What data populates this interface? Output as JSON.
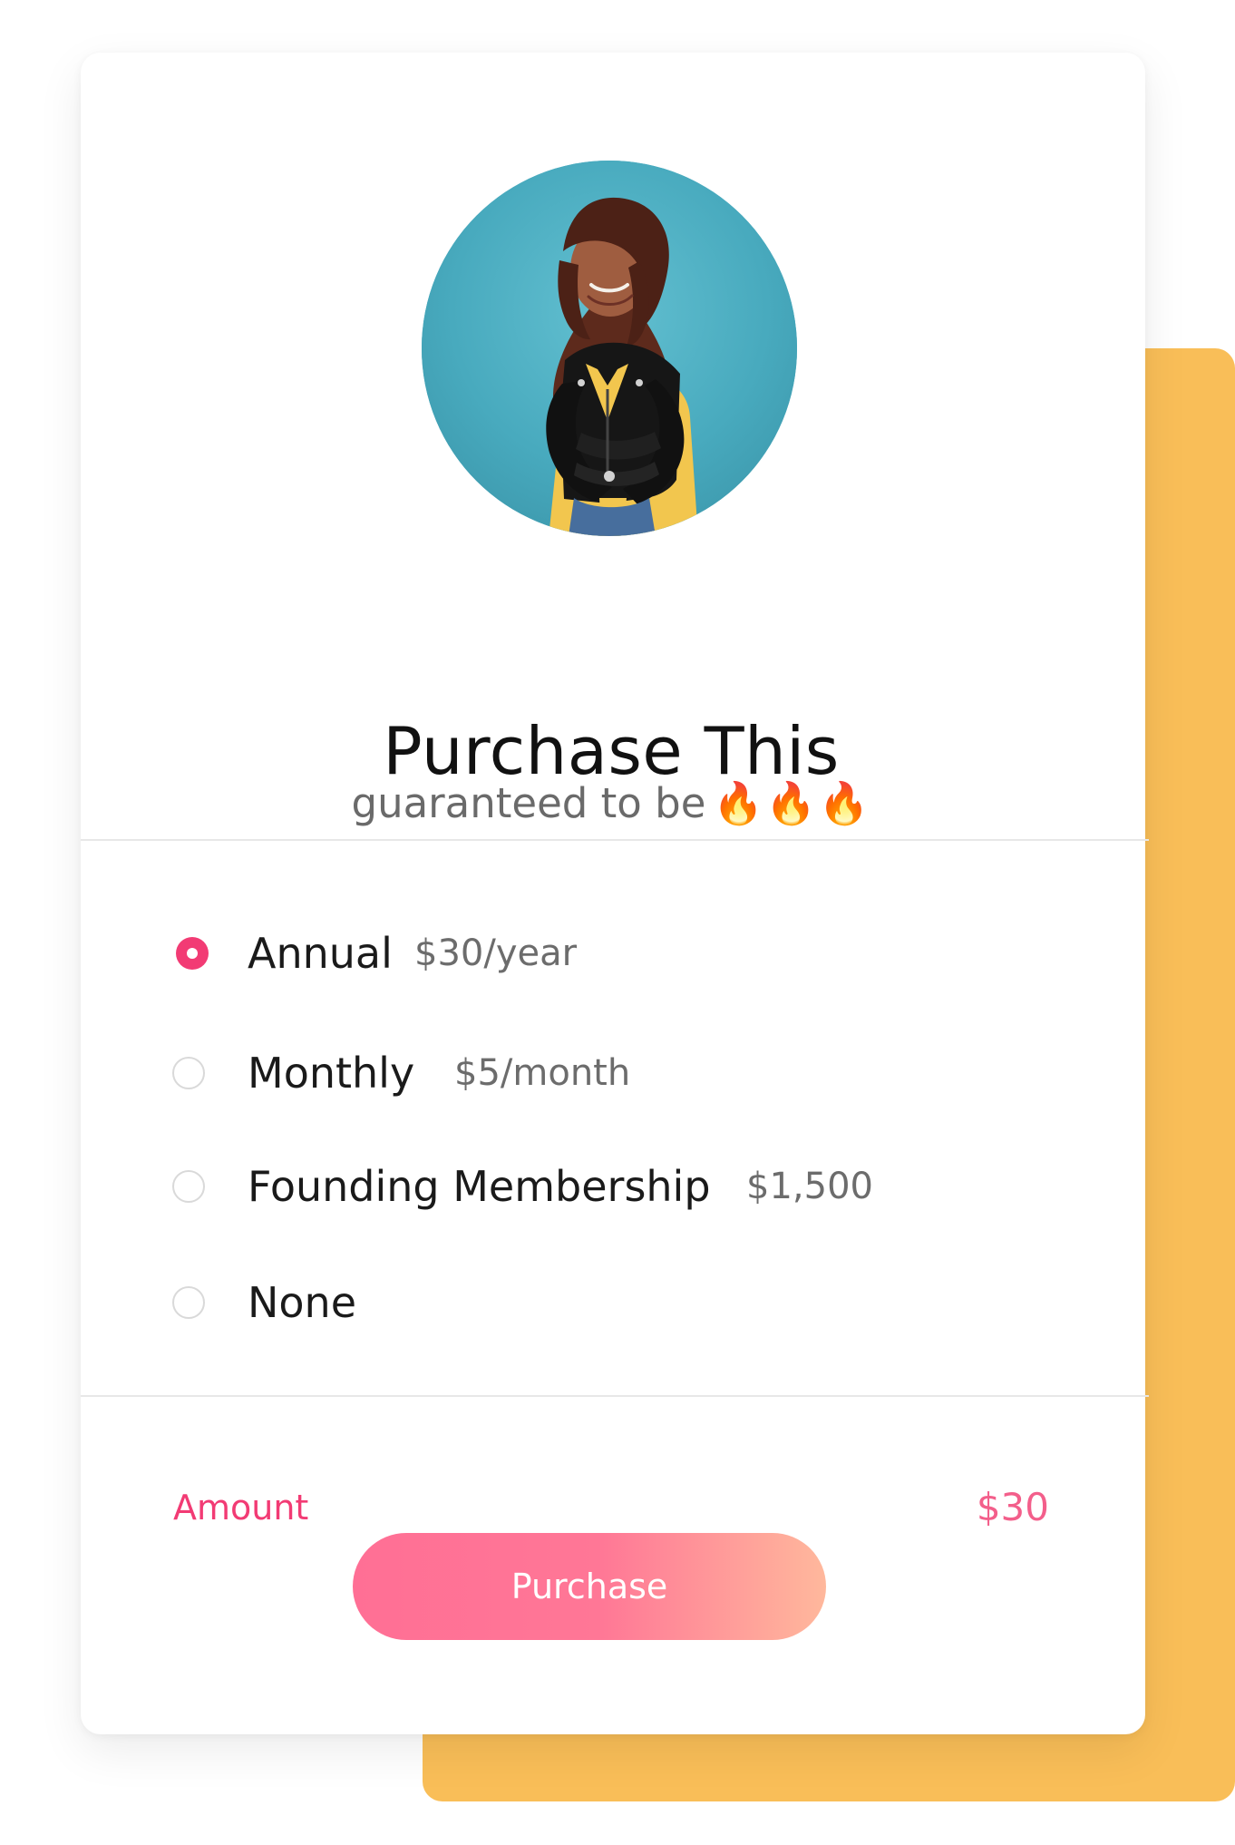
{
  "card": {
    "title": "Purchase This",
    "subtitle": "guaranteed to be",
    "subtitle_emojis": "🔥🔥🔥"
  },
  "plans": [
    {
      "label": "Annual",
      "price": "$30/year",
      "selected": true
    },
    {
      "label": "Monthly",
      "price": "$5/month",
      "selected": false
    },
    {
      "label": "Founding Membership",
      "price": "$1,500",
      "selected": false
    },
    {
      "label": "None",
      "price": "",
      "selected": false
    }
  ],
  "summary": {
    "amount_label": "Amount",
    "amount_value": "$30"
  },
  "actions": {
    "purchase_label": "Purchase"
  },
  "colors": {
    "accent": "#f23b74",
    "backdrop": "#f9be58",
    "button_start": "#ff6f95",
    "button_end": "#ffb89c"
  }
}
